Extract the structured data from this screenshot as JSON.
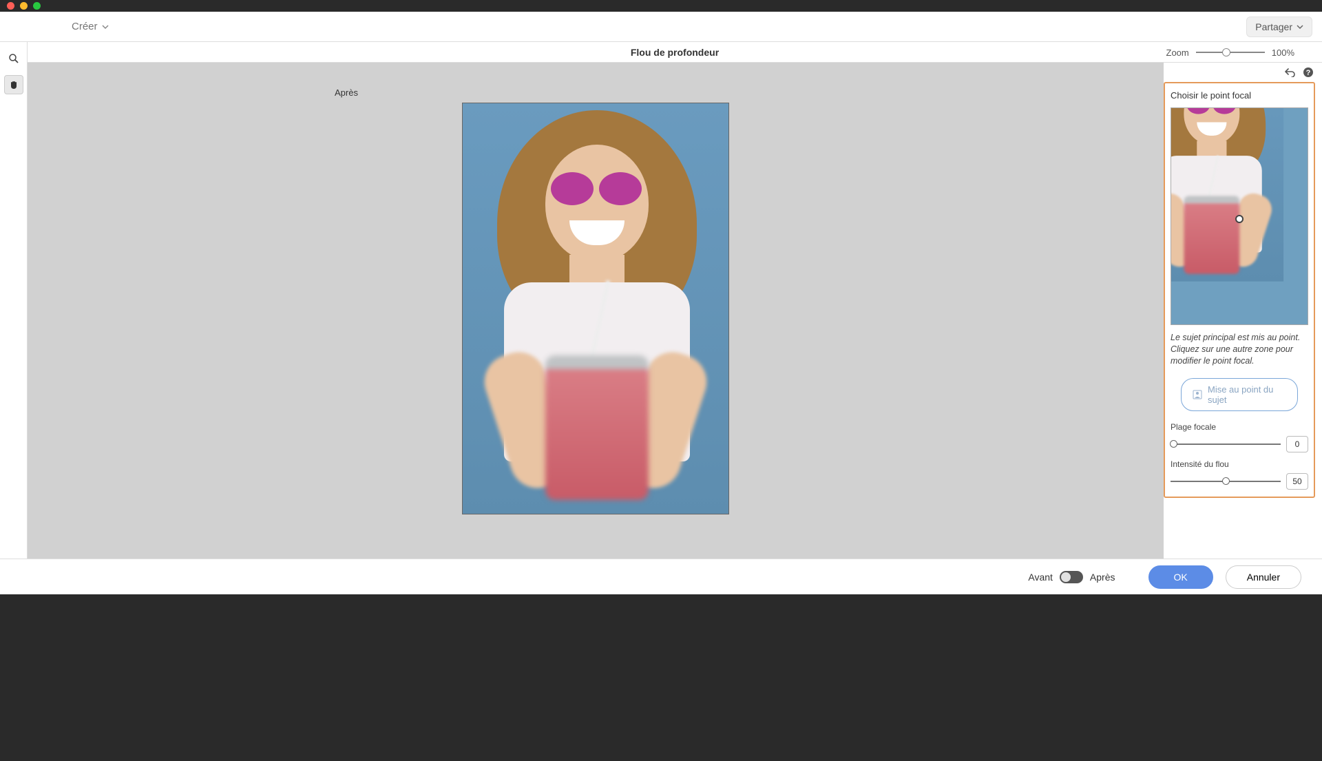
{
  "titlebar": {},
  "toolbar": {
    "create_label": "Créer",
    "share_label": "Partager"
  },
  "canvas": {
    "title": "Flou de profondeur",
    "zoom_label": "Zoom",
    "zoom_value": "100%",
    "preview_label": "Après"
  },
  "panel": {
    "focal_title": "Choisir le point focal",
    "help_text": "Le sujet principal est mis au point. Cliquez sur une autre zone pour modifier le point focal.",
    "auto_focus_label": "Mise au point du sujet",
    "range_label": "Plage focale",
    "range_value": "0",
    "intensity_label": "Intensité du flou",
    "intensity_value": "50"
  },
  "footer": {
    "before_label": "Avant",
    "after_label": "Après",
    "ok_label": "OK",
    "cancel_label": "Annuler"
  }
}
